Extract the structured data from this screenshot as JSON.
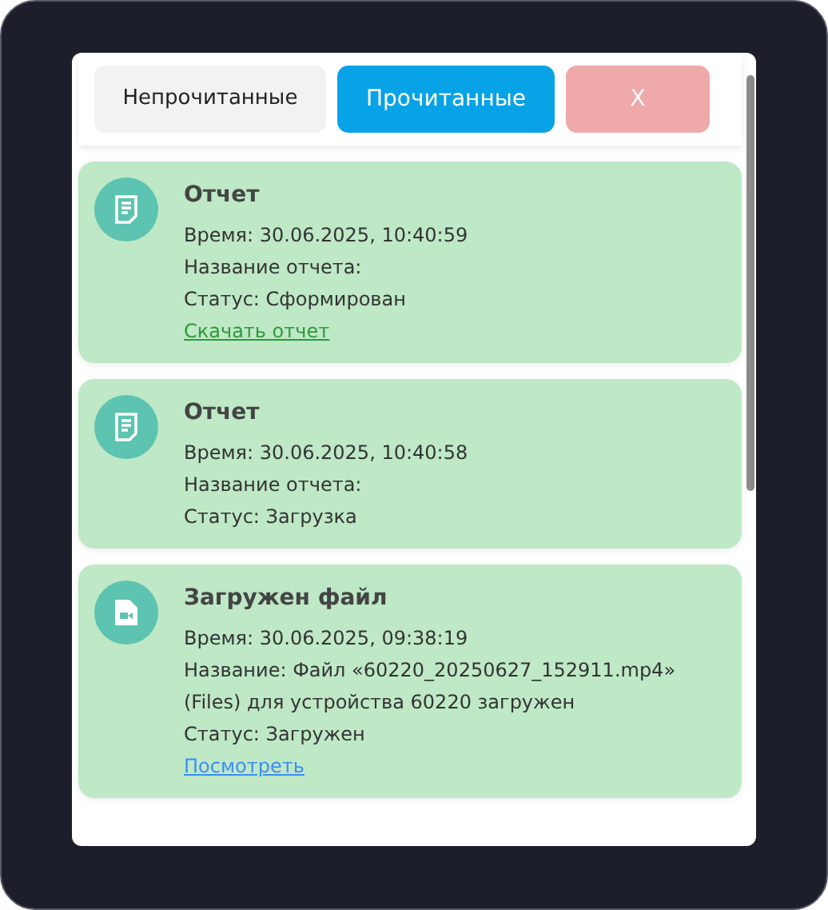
{
  "tabs": [
    {
      "label": "Непрочитанные",
      "kind": "tab",
      "selected": false
    },
    {
      "label": "Прочитанные",
      "kind": "tab",
      "selected": true
    },
    {
      "label": "X",
      "kind": "close"
    }
  ],
  "notifications": [
    {
      "kind": "report",
      "title": "Отчет",
      "lines": [
        "Время: 30.06.2025, 10:40:59",
        "Название отчета:",
        "Статус: Сформирован"
      ],
      "link": {
        "label": "Скачать отчет",
        "color": "#2e9a3a"
      }
    },
    {
      "kind": "report",
      "title": "Отчет",
      "lines": [
        "Время: 30.06.2025, 10:40:58",
        "Название отчета:",
        "Статус: Загрузка"
      ]
    },
    {
      "kind": "file",
      "title": "Загружен файл",
      "lines": [
        "Время: 30.06.2025, 09:38:19",
        "Название: Файл «60220_20250627_152911.mp4» (Files) для устройства 60220 загружен",
        "Статус: Загружен"
      ],
      "link": {
        "label": "Посмотреть",
        "color": "#3a8ef5"
      }
    }
  ]
}
